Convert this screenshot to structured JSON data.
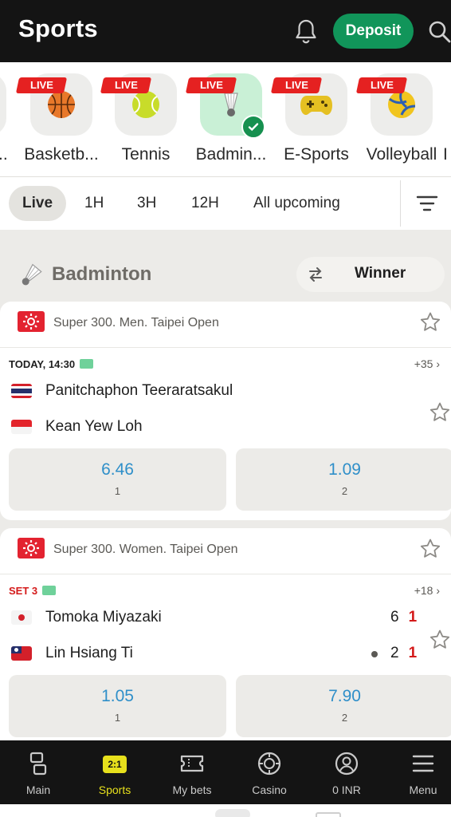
{
  "header": {
    "title": "Sports",
    "deposit_label": "Deposit"
  },
  "sports": [
    {
      "label": "Basketb...",
      "live": "LIVE",
      "icon": "basketball-icon"
    },
    {
      "label": "Tennis",
      "live": "LIVE",
      "icon": "tennis-ball-icon"
    },
    {
      "label": "Badmin...",
      "live": "LIVE",
      "icon": "shuttlecock-icon",
      "selected": true
    },
    {
      "label": "E-Sports",
      "live": "LIVE",
      "icon": "gamepad-icon"
    },
    {
      "label": "Volleyball",
      "live": "LIVE",
      "icon": "volleyball-icon"
    }
  ],
  "filters": {
    "live": "Live",
    "h1": "1H",
    "h3": "3H",
    "h12": "12H",
    "upcoming": "All upcoming"
  },
  "section": {
    "name": "Badminton",
    "market": "Winner"
  },
  "matches": [
    {
      "tournament": "Super 300. Men. Taipei Open",
      "time": "TODAY, 14:30",
      "more": "+35 ›",
      "team1": "Panitchaphon Teeraratsakul",
      "team2": "Kean Yew Loh",
      "odd1": "6.46",
      "odd1_label": "1",
      "odd2": "1.09",
      "odd2_label": "2"
    },
    {
      "tournament": "Super 300. Women. Taipei Open",
      "time": "SET 3",
      "more": "+18 ›",
      "team1": "Tomoka Miyazaki",
      "team2": "Lin Hsiang Ti",
      "team1_sets": "6",
      "team1_points": "1",
      "team2_sets": "2",
      "team2_points": "1",
      "odd1": "1.05",
      "odd1_label": "1",
      "odd2": "7.90",
      "odd2_label": "2"
    }
  ],
  "nav": {
    "main": "Main",
    "sports": "Sports",
    "sports_badge": "2:1",
    "mybets": "My bets",
    "casino": "Casino",
    "balance": "0 INR",
    "menu": "Menu"
  },
  "colors": {
    "header_bg": "#141414",
    "deposit": "#11955a",
    "live_badge": "#e52121",
    "odds": "#2f8fc9",
    "active_nav": "#e7e01c"
  }
}
